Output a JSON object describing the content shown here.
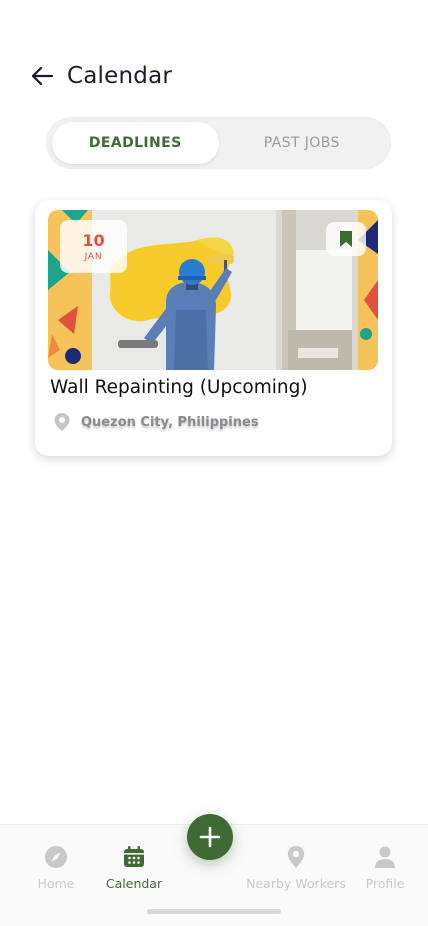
{
  "header": {
    "title": "Calendar",
    "back_icon": "arrow-left-icon"
  },
  "tabs": [
    {
      "label": "DEADLINES",
      "active": true
    },
    {
      "label": "PAST JOBS",
      "active": false
    }
  ],
  "job_card": {
    "date_day": "10",
    "date_month": "JAN",
    "title": "Wall Repainting (Upcoming)",
    "location": "Quezon City, Philippines",
    "bookmark_icon": "bookmark-icon",
    "location_icon": "map-pin-icon"
  },
  "bottom_nav": {
    "items": [
      {
        "label": "Home",
        "icon": "compass-icon",
        "active": false
      },
      {
        "label": "Calendar",
        "icon": "calendar-icon",
        "active": true
      },
      {
        "label": "Nearby Workers",
        "icon": "map-pin-icon",
        "active": false
      },
      {
        "label": "Profile",
        "icon": "user-icon",
        "active": false
      }
    ],
    "fab_icon": "plus-icon"
  },
  "colors": {
    "brand_green": "#3e6a34",
    "date_red": "#e0523e",
    "inactive_gray": "#c9c9c9"
  }
}
